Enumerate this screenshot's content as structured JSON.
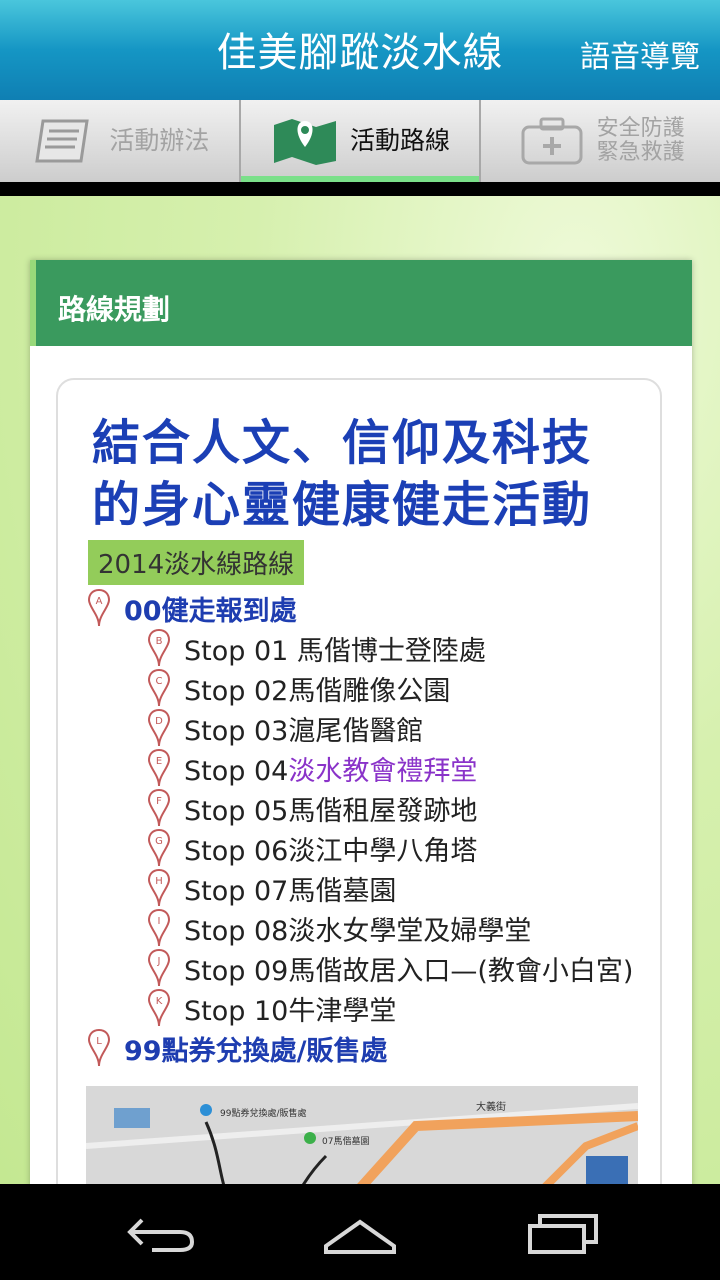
{
  "header": {
    "title": "佳美腳蹤淡水線",
    "voice_label": "語音導覽"
  },
  "tabs": [
    {
      "label": "活動辦法",
      "icon": "document-icon"
    },
    {
      "label": "活動路線",
      "icon": "map-pin-icon"
    },
    {
      "label_line1": "安全防護",
      "label_line2": "緊急救護",
      "icon": "first-aid-kit-icon"
    }
  ],
  "card": {
    "title": "路線規劃"
  },
  "route_image": {
    "headline_line1": "結合人文、信仰及科技",
    "headline_line2": "的身心靈健康健走活動",
    "badge": "2014淡水線路線",
    "start": {
      "marker": "A",
      "text": "00健走報到處"
    },
    "stops": [
      {
        "marker": "B",
        "prefix": "Stop 01 ",
        "name": "馬偕博士登陸處"
      },
      {
        "marker": "C",
        "prefix": "Stop 02",
        "name": "馬偕雕像公園"
      },
      {
        "marker": "D",
        "prefix": "Stop 03",
        "name": "滬尾偕醫館"
      },
      {
        "marker": "E",
        "prefix": "Stop 04",
        "name": "淡水教會禮拜堂"
      },
      {
        "marker": "F",
        "prefix": "Stop 05",
        "name": "馬偕租屋發跡地"
      },
      {
        "marker": "G",
        "prefix": "Stop 06",
        "name": "淡江中學八角塔"
      },
      {
        "marker": "H",
        "prefix": "Stop 07",
        "name": "馬偕墓園"
      },
      {
        "marker": "I",
        "prefix": "Stop 08",
        "name": "淡水女學堂及婦學堂"
      },
      {
        "marker": "J",
        "prefix": "Stop 09",
        "name": "馬偕故居入口—(教會小白宮)"
      },
      {
        "marker": "K",
        "prefix": "Stop 10",
        "name": "牛津學堂"
      }
    ],
    "end": {
      "marker": "L",
      "text": "99點券兌換處/販售處"
    },
    "map_labels": {
      "l": "99點券兌換處/販售處",
      "h": "07馬偕墓園",
      "street": "大義街"
    }
  },
  "nav": {
    "back": "back-icon",
    "home": "home-icon",
    "recents": "recents-icon"
  },
  "colors": {
    "header_blue": "#1596c4",
    "card_green": "#3a9a5e",
    "accent_green": "#7be08a",
    "route_blue": "#1b3fb5",
    "purple": "#8a33c9"
  }
}
